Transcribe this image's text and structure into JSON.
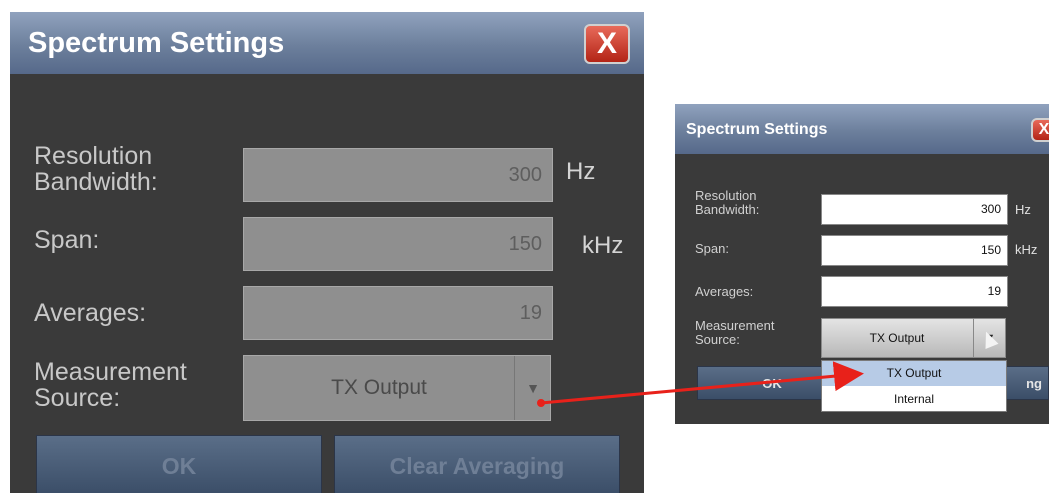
{
  "dialog": {
    "title": "Spectrum Settings",
    "close_glyph": "X",
    "fields": [
      {
        "label": "Resolution\nBandwidth:",
        "value": "300",
        "unit": "Hz"
      },
      {
        "label": "Span:",
        "value": "150",
        "unit": "kHz"
      },
      {
        "label": "Averages:",
        "value": "19",
        "unit": ""
      }
    ],
    "measurement_source": {
      "label": "Measurement\nSource:",
      "value": "TX Output",
      "arrow_icon": "chevron-down-icon"
    },
    "buttons": {
      "ok": "OK",
      "clear": "Clear Averaging"
    }
  },
  "zoom_dialog": {
    "title": "Spectrum Settings",
    "close_glyph": "X",
    "fields": [
      {
        "label": "Resolution\nBandwidth:",
        "value": "300",
        "unit": "Hz"
      },
      {
        "label": "Span:",
        "value": "150",
        "unit": "kHz"
      },
      {
        "label": "Averages:",
        "value": "19",
        "unit": ""
      }
    ],
    "measurement_source": {
      "label": "Measurement\nSource:",
      "value": "TX Output",
      "arrow_icon": "chevron-down-icon"
    },
    "dropdown_options": [
      "TX Output",
      "Internal"
    ],
    "buttons": {
      "ok": "OK",
      "clear_partial": "ng"
    }
  },
  "colors": {
    "callout_arrow": "#e8211a",
    "dialog_bg": "#3a3a3a",
    "title_bar": "#6c7f9c",
    "close_button": "#c23a2a",
    "highlight_option": "#b7cbe6"
  }
}
